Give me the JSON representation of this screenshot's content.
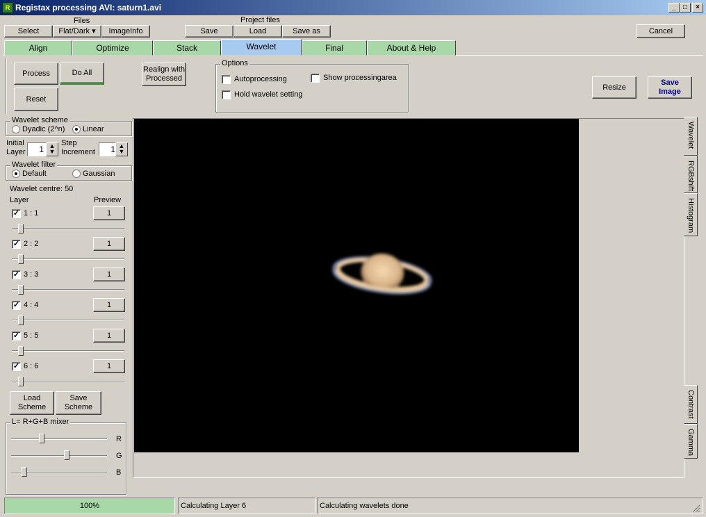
{
  "window": {
    "title": "Registax processing AVI: saturn1.avi",
    "minimize": "_",
    "maximize": "□",
    "close": "×"
  },
  "files": {
    "label": "Files",
    "select": "Select",
    "flatdark": "Flat/Dark ▾",
    "imageinfo": "ImageInfo"
  },
  "project": {
    "label": "Project files",
    "save": "Save",
    "load": "Load",
    "saveas": "Save as"
  },
  "cancel": "Cancel",
  "tabs": [
    "Align",
    "Optimize",
    "Stack",
    "Wavelet",
    "Final",
    "About & Help"
  ],
  "actions": {
    "process": "Process",
    "doall": "Do All",
    "reset": "Reset",
    "realign_line1": "Realign with",
    "realign_line2": "Processed"
  },
  "options": {
    "label": "Options",
    "autoprocessing": "Autoprocessing",
    "hold": "Hold wavelet setting",
    "showarea": "Show processingarea"
  },
  "resize": "Resize",
  "saveimage": {
    "line1": "Save",
    "line2": "Image"
  },
  "scheme": {
    "label": "Wavelet scheme",
    "dyadic": "Dyadic (2^n)",
    "linear": "Linear"
  },
  "initial": {
    "line1": "Initial",
    "line2": "Layer",
    "value": "1"
  },
  "step": {
    "line1": "Step",
    "line2": "Increment",
    "value": "1"
  },
  "filter": {
    "label": "Wavelet filter",
    "default": "Default",
    "gaussian": "Gaussian"
  },
  "centre": "Wavelet centre: 50",
  "layer_header": "Layer",
  "preview_header": "Preview",
  "layers": [
    {
      "label": "1 : 1",
      "preview": "1",
      "checked": true
    },
    {
      "label": "2 : 2",
      "preview": "1",
      "checked": true
    },
    {
      "label": "3 : 3",
      "preview": "1",
      "checked": true
    },
    {
      "label": "4 : 4",
      "preview": "1",
      "checked": true
    },
    {
      "label": "5 : 5",
      "preview": "1",
      "checked": true
    },
    {
      "label": "6 : 6",
      "preview": "1",
      "checked": true
    }
  ],
  "scheme_buttons": {
    "load1": "Load",
    "load2": "Scheme",
    "save1": "Save",
    "save2": "Scheme"
  },
  "mixer": {
    "label": "L= R+G+B mixer",
    "r": "R",
    "g": "G",
    "b": "B"
  },
  "side_tabs": [
    "Wavelet",
    "RGBshift",
    "Histogram"
  ],
  "side_tabs_bottom": [
    "Contrast",
    "Gamma"
  ],
  "status": {
    "progress": "100%",
    "layer": "Calculating Layer 6",
    "done": "Calculating wavelets done"
  },
  "checkmark": "✓",
  "colors": {
    "accent": "#a6caf0",
    "tab": "#a8d8a8",
    "progress": "#a8d8a8",
    "save_image_text": "#00008b"
  }
}
